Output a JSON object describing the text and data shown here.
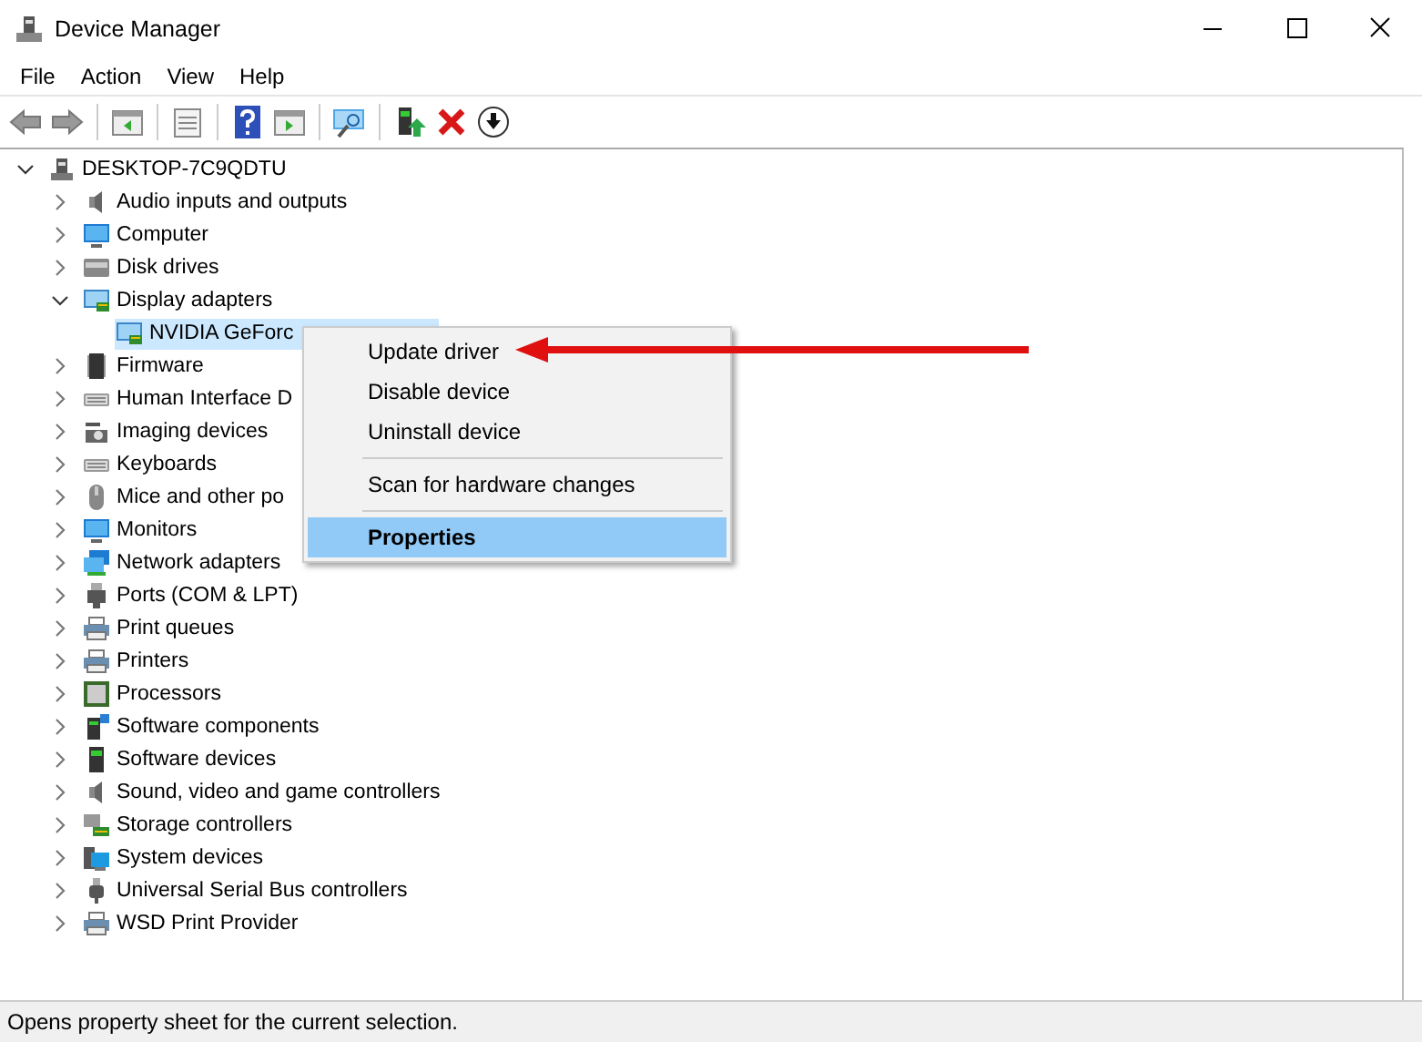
{
  "window": {
    "title": "Device Manager"
  },
  "menu_bar": [
    "File",
    "Action",
    "View",
    "Help"
  ],
  "tree": {
    "label": "DESKTOP-7C9QDTU",
    "expanded": true,
    "children": [
      {
        "label": "Audio inputs and outputs",
        "expanded": false
      },
      {
        "label": "Computer",
        "expanded": false
      },
      {
        "label": "Disk drives",
        "expanded": false
      },
      {
        "label": "Display adapters",
        "expanded": true,
        "children": [
          {
            "label": "NVIDIA GeForc",
            "selected": true
          }
        ]
      },
      {
        "label": "Firmware",
        "expanded": false
      },
      {
        "label": "Human Interface D",
        "expanded": false
      },
      {
        "label": "Imaging devices",
        "expanded": false
      },
      {
        "label": "Keyboards",
        "expanded": false
      },
      {
        "label": "Mice and other po",
        "expanded": false
      },
      {
        "label": "Monitors",
        "expanded": false
      },
      {
        "label": "Network adapters",
        "expanded": false
      },
      {
        "label": "Ports (COM & LPT)",
        "expanded": false
      },
      {
        "label": "Print queues",
        "expanded": false
      },
      {
        "label": "Printers",
        "expanded": false
      },
      {
        "label": "Processors",
        "expanded": false
      },
      {
        "label": "Software components",
        "expanded": false
      },
      {
        "label": "Software devices",
        "expanded": false
      },
      {
        "label": "Sound, video and game controllers",
        "expanded": false
      },
      {
        "label": "Storage controllers",
        "expanded": false
      },
      {
        "label": "System devices",
        "expanded": false
      },
      {
        "label": "Universal Serial Bus controllers",
        "expanded": false
      },
      {
        "label": "WSD Print Provider",
        "expanded": false
      }
    ]
  },
  "context_menu": [
    {
      "kind": "item",
      "label": "Update driver",
      "selected": false,
      "default": false
    },
    {
      "kind": "item",
      "label": "Disable device",
      "selected": false,
      "default": false
    },
    {
      "kind": "item",
      "label": "Uninstall device",
      "selected": false,
      "default": false
    },
    {
      "kind": "separator"
    },
    {
      "kind": "item",
      "label": "Scan for hardware changes",
      "selected": false,
      "default": false
    },
    {
      "kind": "separator"
    },
    {
      "kind": "item",
      "label": "Properties",
      "selected": true,
      "default": true
    }
  ],
  "status_bar": "Opens property sheet for the current selection."
}
